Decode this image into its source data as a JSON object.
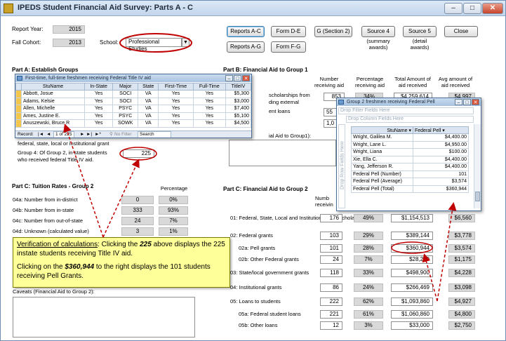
{
  "window": {
    "title": "IPEDS Student Financial Aid Survey: Parts A - C",
    "controls": [
      "–",
      "□",
      "✕"
    ]
  },
  "header": {
    "report_year_label": "Report Year:",
    "report_year": "2015",
    "fall_cohort_label": "Fall Cohort:",
    "fall_cohort": "2013",
    "school_label": "School:",
    "school_value": "Professional Studies",
    "buttons": {
      "reports_ac": "Reports A-C",
      "reports_ag": "Reports A-G",
      "form_de": "Form D-E",
      "form_fg": "Form F-G",
      "g_section2": "G (Section 2)",
      "source4": "Source 4",
      "source4_sub1": "(summary",
      "source4_sub2": "awards)",
      "source5": "Source 5",
      "source5_sub1": "(detail",
      "source5_sub2": "awards)",
      "close": "Close"
    }
  },
  "part_a": {
    "title": "Part A:  Establish Groups",
    "group_label_tail": "federal, state, local or institutional grant",
    "group4_label_line1": "Group 4: Of Group 2, in-state students",
    "group4_label_line2": "who received federal Title IV aid.",
    "group4_value": "225"
  },
  "popup1": {
    "title": "First-time, full-time freshmen receiving Federal Title IV aid",
    "columns": [
      "StuName",
      "In-State",
      "Major",
      "State",
      "First-Time",
      "Full-Time",
      "TitleIV"
    ],
    "rows": [
      [
        "Abbott, Josue",
        "Yes",
        "SOCI",
        "VA",
        "Yes",
        "Yes",
        "$5,300"
      ],
      [
        "Adams, Kelsie",
        "Yes",
        "SOCI",
        "VA",
        "Yes",
        "Yes",
        "$3,000"
      ],
      [
        "Allen, Michelle",
        "Yes",
        "PSYC",
        "VA",
        "Yes",
        "Yes",
        "$7,400"
      ],
      [
        "Ames, Justine E.",
        "Yes",
        "PSYC",
        "VA",
        "Yes",
        "Yes",
        "$5,100"
      ],
      [
        "Anuszewski, Bruce R",
        "Yes",
        "SOWK",
        "VA",
        "Yes",
        "Yes",
        "$4,500"
      ]
    ],
    "nav": {
      "record_label": "Record:",
      "position": "1 of 225",
      "filter": "No Filter",
      "search": "Search"
    }
  },
  "part_b": {
    "title": "Part B:  Financial Aid to Group 1",
    "headers": [
      "Number receiving aid",
      "Percentage receiving aid",
      "Total Amount of aid received",
      "Avg amount of aid received"
    ],
    "row1_label_line1": "scholarships from",
    "row1_label_line2": "ding external",
    "row1_values": [
      "853",
      "34%",
      "$4,259,614",
      "$4,997"
    ],
    "row2_label": "ent loans",
    "row2_values": [
      "55",
      "",
      "",
      ""
    ],
    "row3_values": [
      "1,0",
      "",
      "",
      ""
    ],
    "note_label": "ial Aid to Group1):"
  },
  "popup2": {
    "title": "Group 2 freshmen receiving Federal Pell",
    "drop_filter": "Drop Filter Fields Here",
    "drop_column": "Drop Column Fields Here",
    "drop_row": "Drop Row Fields Here",
    "columns": [
      "StuName",
      "Federal Pell"
    ],
    "rows": [
      [
        "Wright, Galilea M.",
        "$4,400.00"
      ],
      [
        "Wright, Lane L.",
        "$4,950.00"
      ],
      [
        "Wright, Liana",
        "$100.00"
      ],
      [
        "Xie, Ella C.",
        "$4,400.00"
      ],
      [
        "Yang, Jefferson R.",
        "$4,400.00"
      ]
    ],
    "summary": [
      [
        "Federal Pell (Number)",
        "101"
      ],
      [
        "Federal Pell (Average)",
        "$3,574"
      ],
      [
        "Federal Pell (Total)",
        "$360,944"
      ]
    ]
  },
  "part_c_left": {
    "title": "Part C:  Tuition Rates - Group 2",
    "percentage_header": "Percentage",
    "rows": [
      {
        "label": "04a: Number from in-district",
        "number": "0",
        "pct": "0%"
      },
      {
        "label": "04b: Number from in-state",
        "number": "333",
        "pct": "93%"
      },
      {
        "label": "04c: Number from out-of-state",
        "number": "24",
        "pct": "7%"
      },
      {
        "label": "04d: Unknown (calculated value)",
        "number": "3",
        "pct": "1%"
      }
    ],
    "caveats_label": "Caveats (Financial Aid to Group 2):"
  },
  "callout": {
    "line1_underlined": "Verification of calculations",
    "line1_a": ":  Clicking the ",
    "line1_val": "225",
    "line1_b": " above displays the 225 instate students receiving Title IV aid.",
    "line2_a": "Clicking on the ",
    "line2_val": "$360,944",
    "line2_b": " to the right displays the 101 students receiving Pell Grants."
  },
  "part_c_right": {
    "title": "Part C:  Financial Aid to Group 2",
    "header_partial": "Numb receivin",
    "rows": [
      {
        "label": "01: Federal, State, Local and Institution grants/scholarships",
        "number": "176",
        "pct": "49%",
        "total": "$1,154,513",
        "avg": "$6,560"
      },
      {
        "label": "02: Federal grants",
        "number": "103",
        "pct": "29%",
        "total": "$389,144",
        "avg": "$3,778"
      },
      {
        "label": "02a: Pell grants",
        "number": "101",
        "pct": "28%",
        "total": "$360,944",
        "avg": "$3,574"
      },
      {
        "label": "02b: Other Federal grants",
        "number": "24",
        "pct": "7%",
        "total": "$28,200",
        "avg": "$1,175"
      },
      {
        "label": "03: State/local government grants",
        "number": "118",
        "pct": "33%",
        "total": "$498,900",
        "avg": "$4,228"
      },
      {
        "label": "04: Institutional grants",
        "number": "86",
        "pct": "24%",
        "total": "$266,469",
        "avg": "$3,098"
      },
      {
        "label": "05: Loans to students",
        "number": "222",
        "pct": "62%",
        "total": "$1,093,860",
        "avg": "$4,927"
      },
      {
        "label": "05a: Federal student loans",
        "number": "221",
        "pct": "61%",
        "total": "$1,060,860",
        "avg": "$4,800"
      },
      {
        "label": "05b: Other loans",
        "number": "12",
        "pct": "3%",
        "total": "$33,000",
        "avg": "$2,750"
      }
    ]
  },
  "colors": {
    "annotation_red": "#c00000",
    "callout_yellow": "#ffff99",
    "field_gray": "#d9d9d9",
    "title_blue": "#c3d6ec"
  }
}
